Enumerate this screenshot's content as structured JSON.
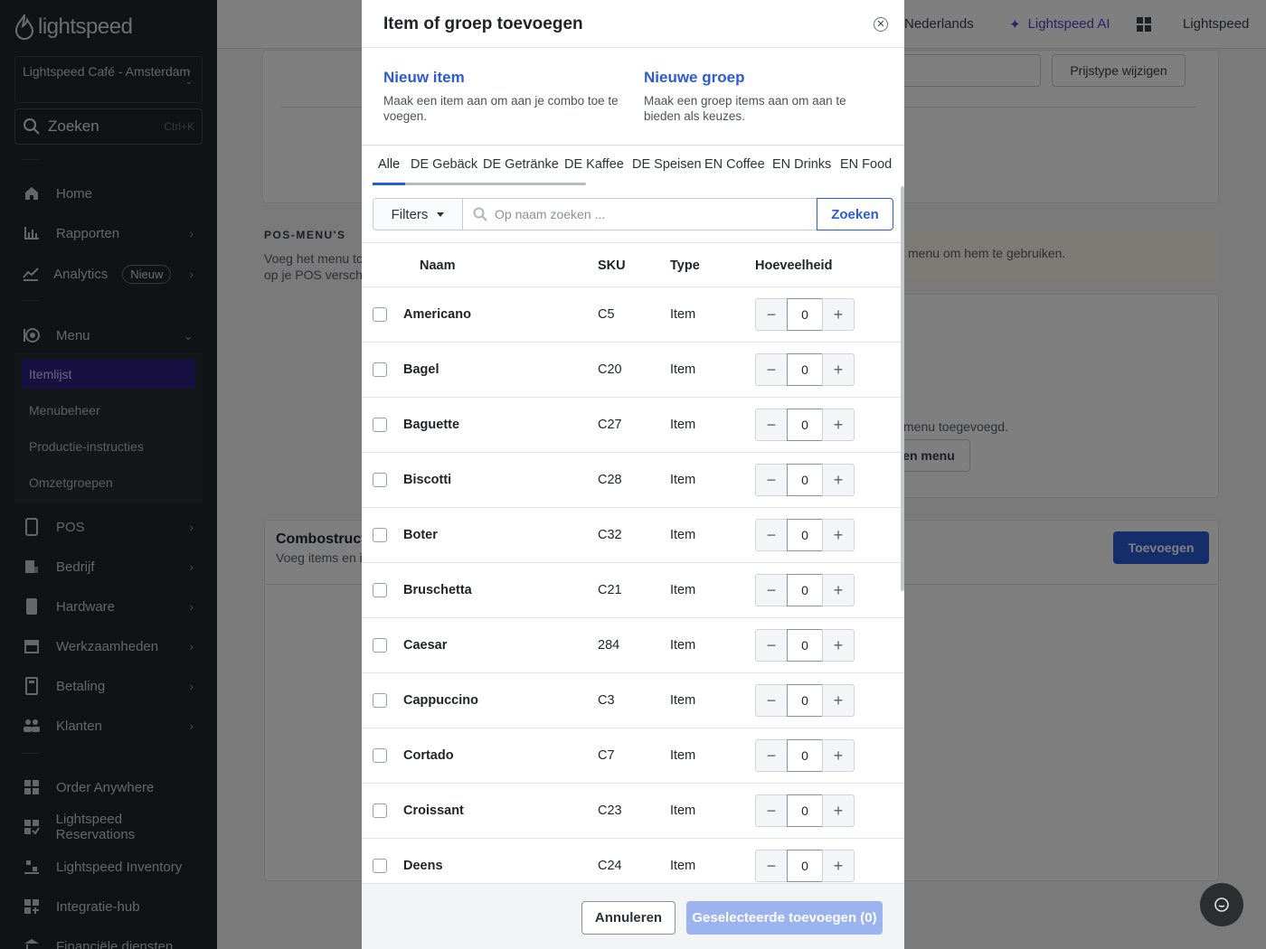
{
  "sidebar": {
    "logo_text": "lightspeed",
    "venue": "Lightspeed Café - Amsterdam",
    "search_label": "Zoeken",
    "search_shortcut": "Ctrl+K",
    "nav": {
      "home": "Home",
      "reports": "Rapporten",
      "analytics": "Analytics",
      "analytics_badge": "Nieuw",
      "menu": "Menu",
      "pos": "POS",
      "company": "Bedrijf",
      "hardware": "Hardware",
      "operations": "Werkzaamheden",
      "payment": "Betaling",
      "customers": "Klanten",
      "order_anywhere": "Order Anywhere",
      "reservations": "Lightspeed Reservations",
      "inventory": "Lightspeed Inventory",
      "integration_hub": "Integratie-hub",
      "financial": "Financiële diensten"
    },
    "menu_sub": {
      "item_list": "Itemlijst",
      "menu_management": "Menubeheer",
      "production": "Productie-instructies",
      "revenue_groups": "Omzetgroepen"
    }
  },
  "topbar": {
    "language": "Nederlands",
    "ai": "Lightspeed AI",
    "account": "Lightspeed"
  },
  "background": {
    "price_type_button": "Prijstype wijzigen",
    "pos_menus_heading": "POS-MENU'S",
    "pos_menus_desc_1": "Voeg het menu to",
    "pos_menus_desc_2": "op je POS verschij",
    "menu_hint": "menu om hem te gebruiken.",
    "menu_added": "menu toegevoegd.",
    "menu_button": "en menu",
    "combo_title": "Combostructu",
    "combo_desc": "Voeg items en it",
    "add_button": "Toevoegen"
  },
  "modal": {
    "title": "Item of groep toevoegen",
    "new_item": {
      "title": "Nieuw item",
      "desc": "Maak een item aan om aan je combo toe te voegen."
    },
    "new_group": {
      "title": "Nieuwe groep",
      "desc": "Maak een groep items aan om aan te bieden als keuzes."
    },
    "tabs": [
      "Alle",
      "DE Gebäck",
      "DE Getränke",
      "DE Kaffee",
      "DE Speisen",
      "EN Coffee",
      "EN Drinks",
      "EN Food"
    ],
    "filters_label": "Filters",
    "search_placeholder": "Op naam zoeken ...",
    "search_button": "Zoeken",
    "columns": {
      "name": "Naam",
      "sku": "SKU",
      "type": "Type",
      "quantity": "Hoeveelheid"
    },
    "rows": [
      {
        "name": "Americano",
        "sku": "C5",
        "type": "Item",
        "qty": "0"
      },
      {
        "name": "Bagel",
        "sku": "C20",
        "type": "Item",
        "qty": "0"
      },
      {
        "name": "Baguette",
        "sku": "C27",
        "type": "Item",
        "qty": "0"
      },
      {
        "name": "Biscotti",
        "sku": "C28",
        "type": "Item",
        "qty": "0"
      },
      {
        "name": "Boter",
        "sku": "C32",
        "type": "Item",
        "qty": "0"
      },
      {
        "name": "Bruschetta",
        "sku": "C21",
        "type": "Item",
        "qty": "0"
      },
      {
        "name": "Caesar",
        "sku": "284",
        "type": "Item",
        "qty": "0"
      },
      {
        "name": "Cappuccino",
        "sku": "C3",
        "type": "Item",
        "qty": "0"
      },
      {
        "name": "Cortado",
        "sku": "C7",
        "type": "Item",
        "qty": "0"
      },
      {
        "name": "Croissant",
        "sku": "C23",
        "type": "Item",
        "qty": "0"
      },
      {
        "name": "Deens",
        "sku": "C24",
        "type": "Item",
        "qty": "0"
      }
    ],
    "cancel_button": "Annuleren",
    "add_selected_button": "Geselecteerde toevoegen (0)"
  },
  "colors": {
    "accent": "#2b5cd7",
    "sidebar_bg": "#232529",
    "active_nav": "#2e2180",
    "primary_disabled": "#9bb3ef"
  }
}
